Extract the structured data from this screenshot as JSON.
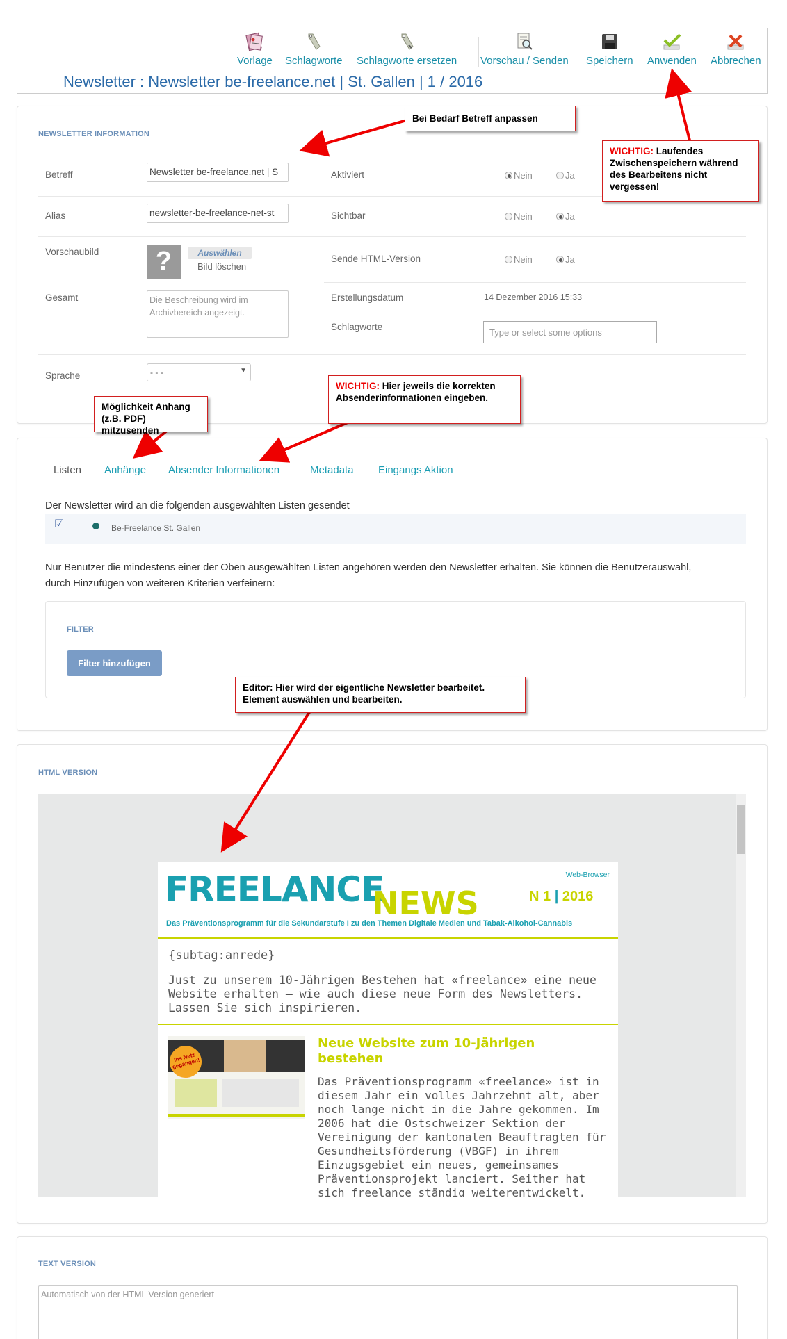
{
  "toolbar": {
    "buttons": [
      {
        "label": "Vorlage",
        "icon": "template-icon"
      },
      {
        "label": "Schlagworte",
        "icon": "tag-icon"
      },
      {
        "label": "Schlagworte ersetzen",
        "icon": "tag-replace-icon"
      },
      {
        "label": "Vorschau / Senden",
        "icon": "preview-icon"
      },
      {
        "label": "Speichern",
        "icon": "save-icon"
      },
      {
        "label": "Anwenden",
        "icon": "check-icon"
      },
      {
        "label": "Abbrechen",
        "icon": "cancel-icon"
      }
    ],
    "title": "Newsletter : Newsletter be-freelance.net | St. Gallen | 1 / 2016"
  },
  "info": {
    "section_title": "NEWSLETTER INFORMATION",
    "betreff_label": "Betreff",
    "betreff_value": "Newsletter be-freelance.net | S",
    "alias_label": "Alias",
    "alias_value": "newsletter-be-freelance-net-st",
    "vorschau_label": "Vorschaubild",
    "auswaehlen": "Auswählen",
    "bild_loeschen": "Bild löschen",
    "gesamt_label": "Gesamt",
    "gesamt_placeholder": "Die Beschreibung wird im Archivbereich angezeigt.",
    "sprache_label": "Sprache",
    "sprache_value": "- - -",
    "aktiviert_label": "Aktiviert",
    "sichtbar_label": "Sichtbar",
    "html_label": "Sende HTML-Version",
    "nein": "Nein",
    "ja": "Ja",
    "erstellung_label": "Erstellungsdatum",
    "erstellung_value": "14 Dezember 2016 15:33",
    "schlagworte_label": "Schlagworte",
    "schlagworte_placeholder": "Type or select some options",
    "aktiviert_selected": "Nein",
    "sichtbar_selected": "Ja",
    "html_selected": "Ja"
  },
  "callouts": {
    "betreff": "Bei Bedarf Betreff anpassen",
    "save_w": "WICHTIG:",
    "save_text": "Laufendes Zwischenspeichern während des Bearbeitens nicht vergessen!",
    "anhang": "Möglichkeit Anhang (z.B. PDF) mitzusenden",
    "sender_w": "WICHTIG:",
    "sender_text": "Hier jeweils die korrekten Absenderinformationen eingeben.",
    "editor": "Editor: Hier wird der eigentliche Newsletter bearbeitet. Element auswählen und bearbeiten."
  },
  "tabs": [
    "Listen",
    "Anhänge",
    "Absender Informationen",
    "Metadata",
    "Eingangs Aktion"
  ],
  "lists": {
    "intro": "Der Newsletter wird an die folgenden ausgewählten Listen gesendet",
    "item": "Be-Freelance St. Gallen",
    "note": "Nur Benutzer die mindestens einer der Oben ausgewählten Listen angehören werden den Newsletter erhalten. Sie können die Benutzerauswahl, durch Hinzufügen von weiteren Kriterien verfeinern:",
    "filter_title": "FILTER",
    "filter_button": "Filter hinzufügen"
  },
  "html_version": {
    "section_title": "HTML VERSION",
    "web_browser": "Web-Browser",
    "logo_a": "FREELANCE",
    "logo_b": "NEWS",
    "issue_n": "N 1",
    "issue_year": "2016",
    "tagline": "Das Präventionsprogramm für die Sekundarstufe I zu den Themen Digitale Medien und Tabak-Alkohol-Cannabis",
    "anrede": "{subtag:anrede}",
    "intro": "Just zu unserem 10-Jährigen Bestehen hat «freelance» eine neue Website erhalten – wie auch diese neue Form des Newsletters. Lassen Sie sich inspirieren.",
    "article_title": "Neue Website zum 10-Jährigen bestehen",
    "article_text": "Das Präventionsprogramm «freelance» ist in diesem Jahr ein volles Jahrzehnt alt, aber noch lange nicht in die Jahre gekommen. Im 2006 hat die Ostschweizer Sektion der Vereinigung der kantonalen Beauftragten für Gesundheitsförderung (VBGF) in ihrem Einzugsgebiet ein neues, gemeinsames Präventionsprojekt lanciert. Seither hat sich freelance ständig weiterentwickelt.",
    "thumb_badge": "Ins Netz gegangen!"
  },
  "text_version": {
    "section_title": "TEXT VERSION",
    "placeholder": "Automatisch von der HTML Version generiert"
  },
  "colors": {
    "accent": "#1a9db3",
    "brand_teal": "#1aa0b0",
    "brand_lime": "#c8d400",
    "callout_border": "#d21f1f"
  }
}
